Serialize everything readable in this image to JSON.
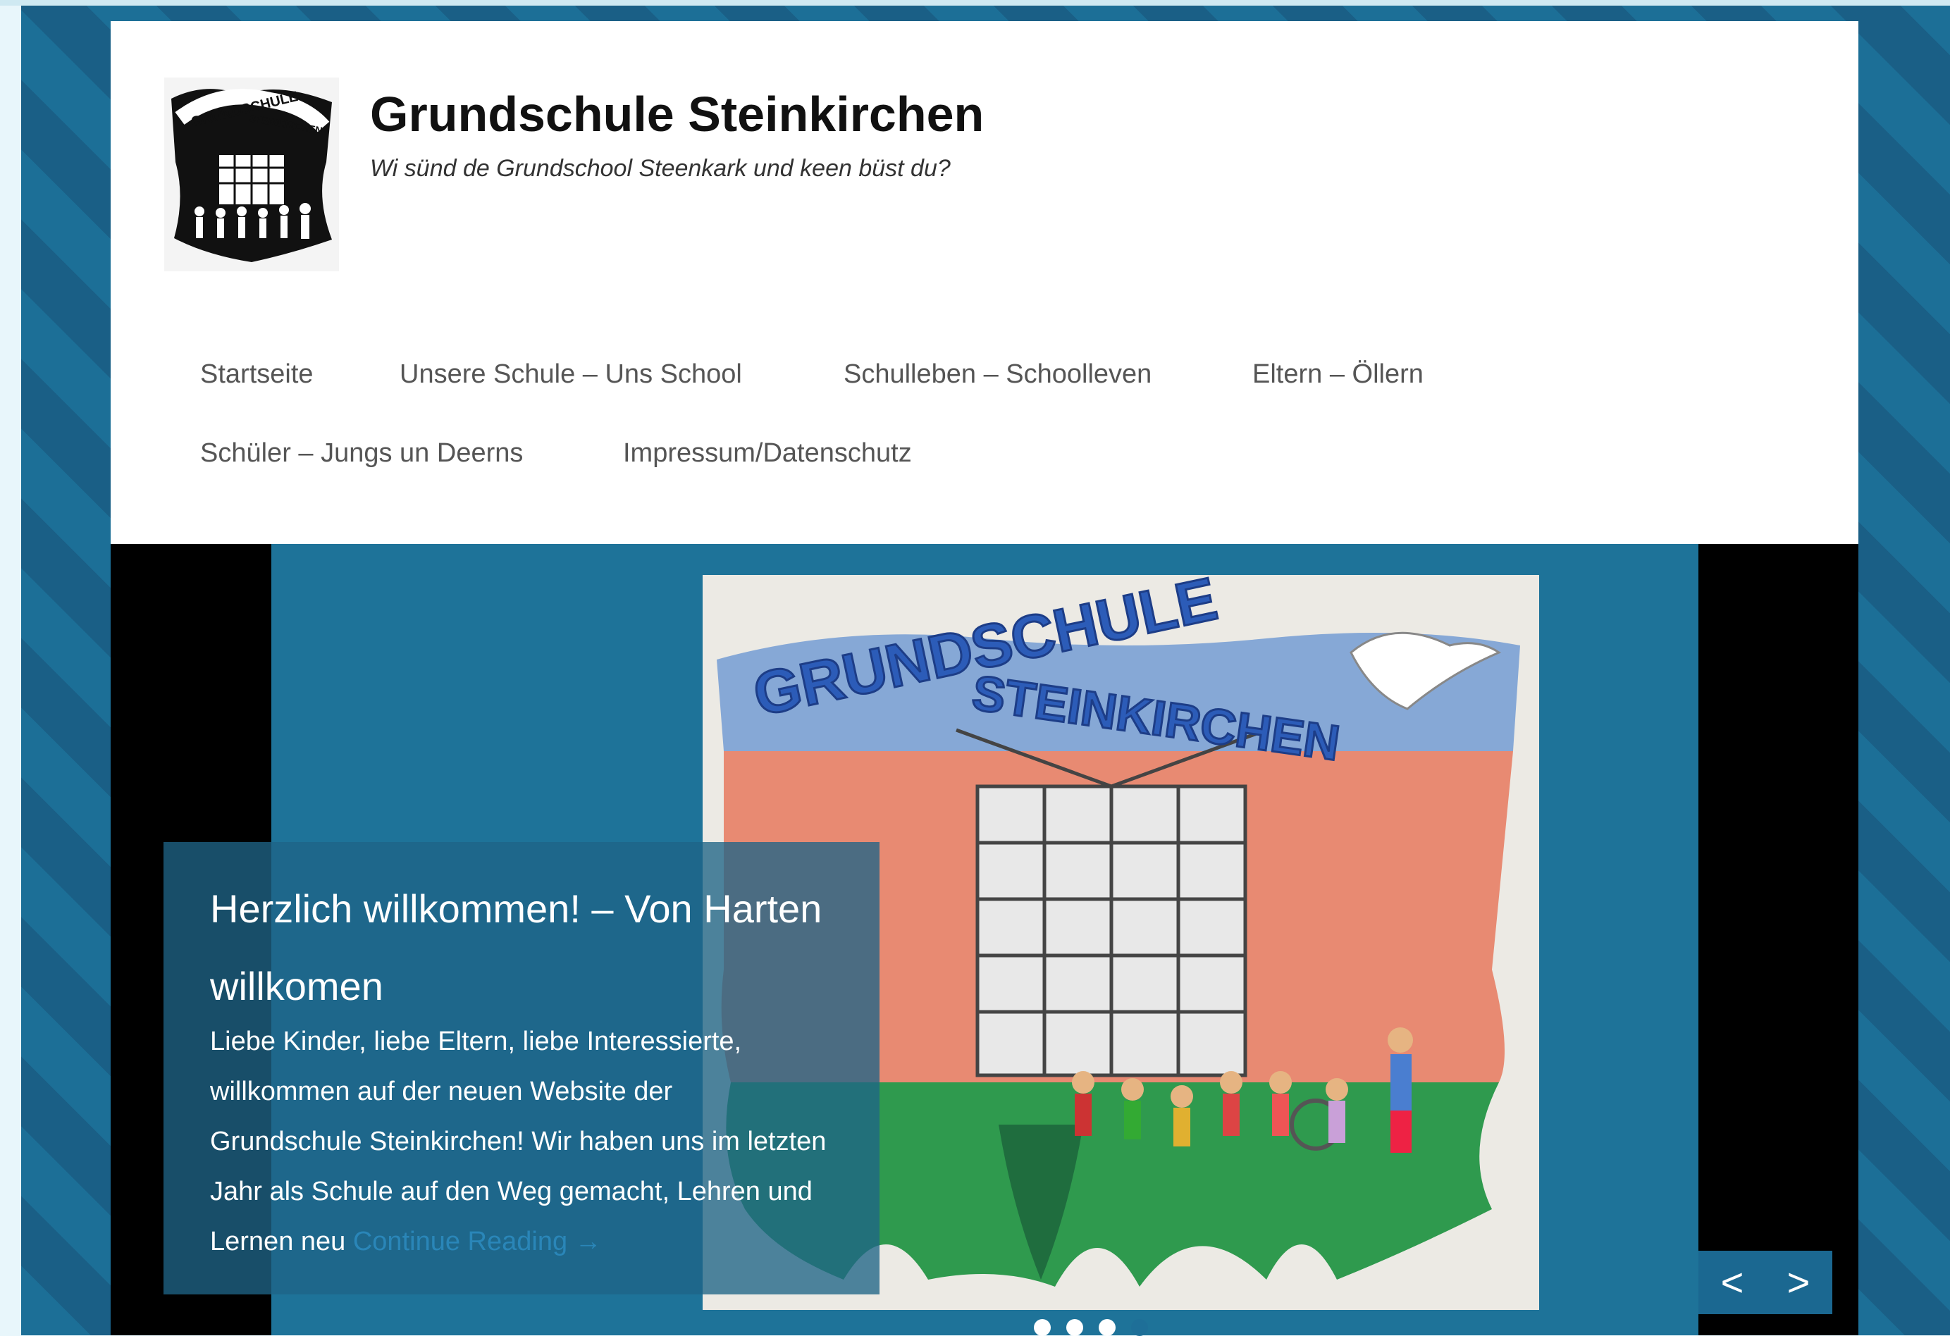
{
  "site": {
    "title": "Grundschule Steinkirchen",
    "tagline": "Wi sünd de Grundschool Steenkark und keen büst du?"
  },
  "nav": {
    "items": [
      {
        "label": "Startseite"
      },
      {
        "label": "Unsere Schule – Uns School"
      },
      {
        "label": "Schulleben – Schoolleven"
      },
      {
        "label": "Eltern – Öllern"
      },
      {
        "label": "Schüler – Jungs un Deerns"
      },
      {
        "label": "Impressum/Datenschutz"
      }
    ]
  },
  "slider": {
    "drawing_text": [
      "GRUNDSCHULE",
      "STEINKIRCHEN"
    ],
    "caption_title": "Herzlich willkommen! – Von Harten willkomen",
    "caption_text": "Liebe Kinder, liebe Eltern, liebe Interessierte, willkommen auf der neuen Website der Grundschule Steinkirchen! Wir haben uns im letzten Jahr als Schule auf den Weg gemacht, Lehren und Lernen neu",
    "read_more": "Continue Reading →",
    "dots_total": 4,
    "dots_active": 4,
    "prev_label": "<",
    "next_label": ">"
  },
  "logo": {
    "text": [
      "GRUNDSCHULE",
      "STEINKIRCHEN"
    ]
  },
  "colors": {
    "page_bg": "#1f7198",
    "header_bg": "#ffffff",
    "caption_bg": "#1f6487",
    "link": "#2a86b8"
  }
}
